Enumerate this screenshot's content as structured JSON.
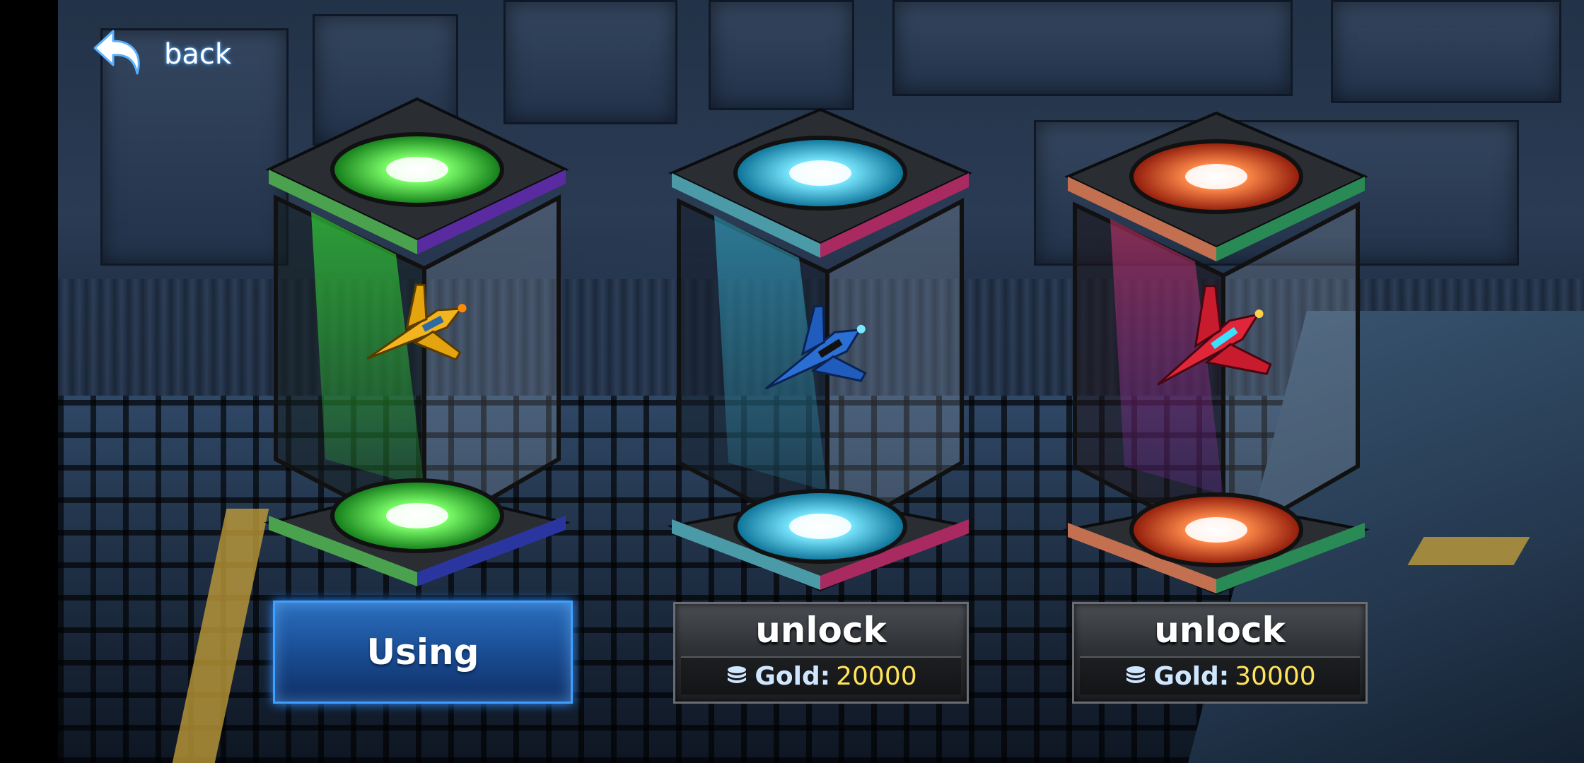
{
  "header": {
    "back_label": "back"
  },
  "ships": [
    {
      "color": "#f2b51e",
      "glow": "#39ff3c",
      "status": "using",
      "action_label": "Using"
    },
    {
      "color": "#2b6fd4",
      "glow": "#3fd8ff",
      "status": "locked",
      "action_label": "unlock",
      "currency_label": "Gold:",
      "price": "20000"
    },
    {
      "color": "#e0263a",
      "glow": "#ff4a24",
      "status": "locked",
      "action_label": "unlock",
      "currency_label": "Gold:",
      "price": "30000"
    }
  ],
  "colors": {
    "using_accent": "#3ea0ff",
    "price_color": "#ffe35a",
    "label_color": "#cfe6ff"
  },
  "icons": {
    "back": "back-arrow-icon",
    "currency": "gold-coin-stack-icon"
  }
}
